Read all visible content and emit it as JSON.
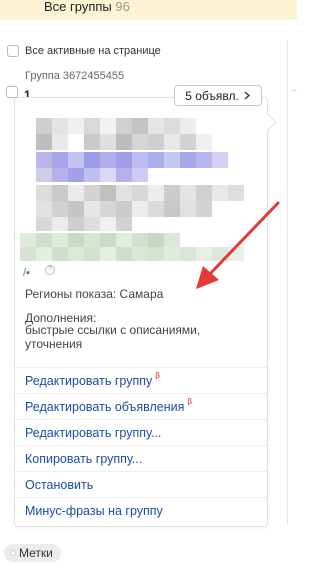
{
  "header": {
    "all_groups_label": "Все группы",
    "all_groups_count": "96"
  },
  "list": {
    "select_all_label": "Все активные на странице",
    "group_id_text": "Группа 3672455455",
    "group_number": "1"
  },
  "card": {
    "ads_button_label": "5 объявл.",
    "ads_button_icon": "chevron-right-icon",
    "regions_text": "Регионы показа: Самара",
    "extras_title": "Дополнения:",
    "extras_text": "быстрые ссылки с описаниями, уточнения"
  },
  "menu": {
    "items": [
      {
        "label": "Редактировать группу",
        "beta": "β"
      },
      {
        "label": "Редактировать объявления",
        "beta": "β"
      },
      {
        "label": "Редактировать группу..."
      },
      {
        "label": "Копировать группу..."
      },
      {
        "label": "Остановить"
      },
      {
        "label": "Минус-фразы на группу"
      }
    ]
  },
  "tags": {
    "label": "Метки"
  },
  "colors": {
    "link": "#1b4da8",
    "beta": "#dd2222",
    "header_bg": "#fbf3d3",
    "arrow": "#e53935"
  }
}
